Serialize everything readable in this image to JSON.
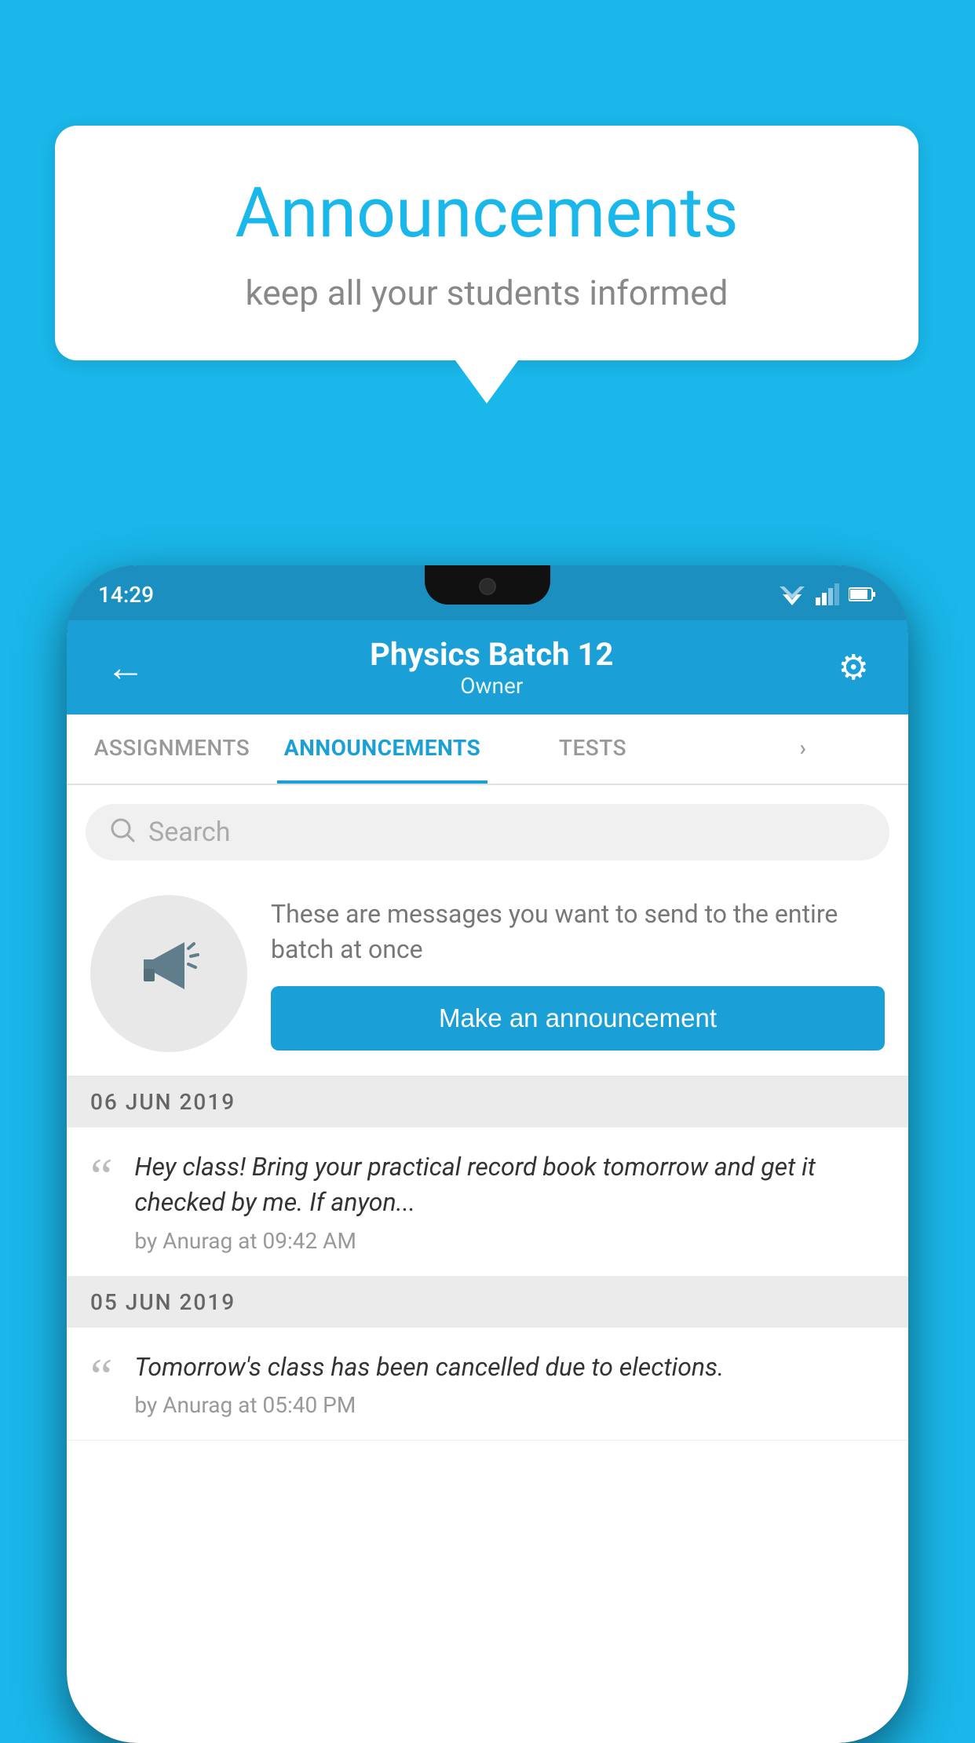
{
  "background_color": "#1ab7ea",
  "speech_bubble": {
    "title": "Announcements",
    "subtitle": "keep all your students informed"
  },
  "status_bar": {
    "time": "14:29"
  },
  "app_bar": {
    "title": "Physics Batch 12",
    "subtitle": "Owner",
    "back_icon": "←",
    "settings_icon": "⚙"
  },
  "tabs": [
    {
      "label": "ASSIGNMENTS",
      "active": false
    },
    {
      "label": "ANNOUNCEMENTS",
      "active": true
    },
    {
      "label": "TESTS",
      "active": false
    },
    {
      "label": "›",
      "active": false
    }
  ],
  "search": {
    "placeholder": "Search"
  },
  "announcement_placeholder": {
    "description": "These are messages you want to send to the entire batch at once",
    "button_label": "Make an announcement"
  },
  "announcements": [
    {
      "date": "06  JUN  2019",
      "text": "Hey class! Bring your practical record book tomorrow and get it checked by me. If anyon...",
      "meta": "by Anurag at 09:42 AM"
    },
    {
      "date": "05  JUN  2019",
      "text": "Tomorrow's class has been cancelled due to elections.",
      "meta": "by Anurag at 05:40 PM"
    }
  ]
}
